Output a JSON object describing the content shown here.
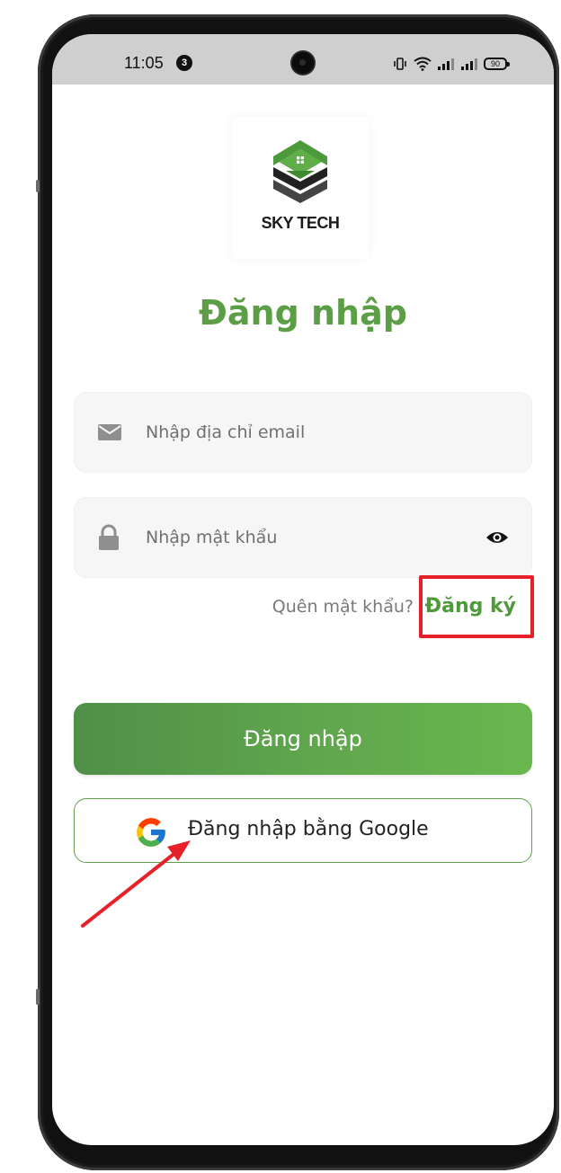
{
  "status_bar": {
    "time": "11:05",
    "notification_count": "3",
    "battery_level": "90"
  },
  "logo": {
    "text": "SKY TECH"
  },
  "title": "Đăng nhập",
  "email_field": {
    "placeholder": "Nhập địa chỉ email",
    "icon": "mail-icon"
  },
  "password_field": {
    "placeholder": "Nhập mật khẩu",
    "icon": "lock-icon",
    "toggle_icon": "eye-icon"
  },
  "forgot_password_label": "Quên mật khẩu?",
  "signup_label": "Đăng ký",
  "login_button_label": "Đăng nhập",
  "google_button_label": "Đăng nhập bằng Google",
  "colors": {
    "accent": "#5c9e46",
    "highlight": "#e8202a",
    "arrow": "#e8202a"
  }
}
